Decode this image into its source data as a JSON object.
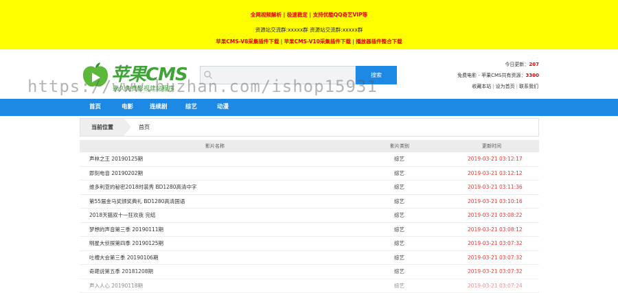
{
  "top_banner": {
    "line1": "全网视频解析 | 极速稳定 | 支持优酷QQ奇艺VIP等",
    "line2": "资源站交流群:xxxxx群 资源站交流群:xxxxx群",
    "line3_parts": [
      "苹果CMS-V8采集插件下载",
      " | ",
      "苹果CMS-V10采集插件下载",
      " | ",
      "播放器插件整合下载"
    ]
  },
  "logo": {
    "brand": "苹果CMS",
    "tagline": "永久免费影视建站程序"
  },
  "search": {
    "placeholder": "",
    "button": "搜索"
  },
  "stats": {
    "today_label": "今日更新：",
    "today_value": "207",
    "total_label": "免费电影 - 苹果CMS共有资源：",
    "total_value": "3300",
    "links": [
      "收藏本站",
      "设为首页",
      "联系我们"
    ]
  },
  "watermark": "https://www.huzhan.com/ishop15931",
  "nav": [
    "首页",
    "电影",
    "连续剧",
    "综艺",
    "动漫"
  ],
  "breadcrumb": {
    "label": "当前位置",
    "current": "首页"
  },
  "table": {
    "headers": [
      "影片名称",
      "影片类别",
      "更新时间"
    ],
    "rows": [
      [
        "声林之王 20190125期",
        "综艺",
        "2019-03-21 03:12:17"
      ],
      [
        "即刻电音 20190202期",
        "综艺",
        "2019-03-21 03:12:12"
      ],
      [
        "维多利亚的秘密2018时装秀 BD1280高清中字",
        "综艺",
        "2019-03-21 03:11:36"
      ],
      [
        "第55届金马奖颁奖典礼 BD1280高清国语",
        "综艺",
        "2019-03-21 03:10:16"
      ],
      [
        "2018天猫双十一狂欢夜 完结",
        "综艺",
        "2019-03-21 03:08:22"
      ],
      [
        "梦想的声音第三季 20190111期",
        "综艺",
        "2019-03-21 03:08:12"
      ],
      [
        "明星大侦探第四季 20190125期",
        "综艺",
        "2019-03-21 03:07:32"
      ],
      [
        "吐槽大会第三季 20190106期",
        "综艺",
        "2019-03-21 03:07:32"
      ],
      [
        "奇葩说第五季 20181208期",
        "综艺",
        "2019-03-21 03:07:32"
      ],
      [
        "声入人心 20190118期",
        "综艺",
        "2019-03-21 03:07:24"
      ]
    ]
  },
  "colors": {
    "banner_bg": "#ffff00",
    "accent": "#1e88e5",
    "time_red": "#e53935",
    "brand_green": "#3fa338"
  }
}
